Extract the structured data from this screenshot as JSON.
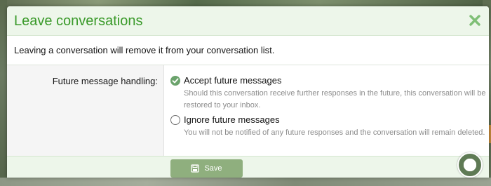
{
  "overlay": {
    "title": "Leave conversations",
    "intro": "Leaving a conversation will remove it from your conversation list."
  },
  "form": {
    "label": "Future message handling:",
    "options": [
      {
        "label": "Accept future messages",
        "description": "Should this conversation receive further responses in the future, this conversation will be restored to your inbox.",
        "checked": true
      },
      {
        "label": "Ignore future messages",
        "description": "You will not be notified of any future responses and the conversation will remain deleted.",
        "checked": false
      }
    ],
    "save_label": "Save"
  },
  "icons": {
    "close": "close-icon",
    "check": "check-icon",
    "save": "save-icon"
  },
  "colors": {
    "accent_green": "#3a9a2a",
    "header_bg": "#edf6ea",
    "button_bg": "#8faf7e",
    "radio_checked": "#6ba36c"
  }
}
